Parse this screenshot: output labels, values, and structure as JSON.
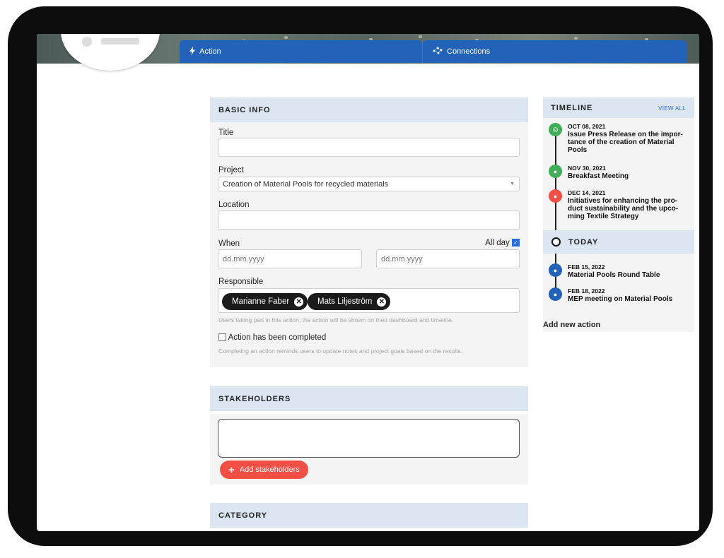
{
  "tabs": [
    {
      "label": "Action",
      "icon": "bolt-icon"
    },
    {
      "label": "Connections",
      "icon": "connections-icon"
    }
  ],
  "basic_info": {
    "heading": "BASIC INFO",
    "title_label": "Title",
    "title_value": "",
    "project_label": "Project",
    "project_value": "Creation of Material Pools for recycled materials",
    "location_label": "Location",
    "location_value": "",
    "when_label": "When",
    "all_day_label": "All day",
    "all_day_checked": true,
    "start_date_placeholder": "dd.mm.yyyy",
    "end_date_placeholder": "dd.mm.yyyy",
    "responsible_label": "Responsible",
    "responsible": [
      "Marianne Faber",
      "Mats Liljeström"
    ],
    "responsible_hint": "Users taking part in this action, the action will be shown on their dashboard and timeline.",
    "completed_label": "Action has been completed",
    "completed_checked": false,
    "completed_hint": "Completing an action reminds users to update notes and project goals based on the results."
  },
  "stakeholders": {
    "heading": "STAKEHOLDERS",
    "add_button": "Add stakeholders"
  },
  "category": {
    "heading": "CATEGORY"
  },
  "timeline": {
    "heading": "TIMELINE",
    "view_all": "VIEW ALL",
    "today_label": "TODAY",
    "add_new_action": "Add new action",
    "past_events": [
      {
        "date": "OCT 08, 2021",
        "title": "Issue Press Release on the impor-tance of the creation of Material Pools",
        "icon": "target-icon",
        "color": "#3fae57"
      },
      {
        "date": "NOV 30, 2021",
        "title": "Breakfast Meeting",
        "icon": "chat-icon",
        "color": "#3fae57"
      },
      {
        "date": "DEC 14, 2021",
        "title": "Initiatives for enhancing the pro-duct sustainability and the upco-ming Textile Strategy",
        "icon": "chat-icon",
        "color": "#f44f45"
      }
    ],
    "future_events": [
      {
        "date": "FEB 15, 2022",
        "title": "Material Pools Round Table",
        "icon": "chat-icon",
        "color": "#2262b8"
      },
      {
        "date": "FEB 18, 2022",
        "title": "MEP meeting on Material Pools",
        "icon": "chat-icon",
        "color": "#2262b8"
      }
    ]
  },
  "colors": {
    "accent_blue": "#2262b8",
    "accent_red": "#f44f45",
    "section_header": "#dce5f2"
  }
}
